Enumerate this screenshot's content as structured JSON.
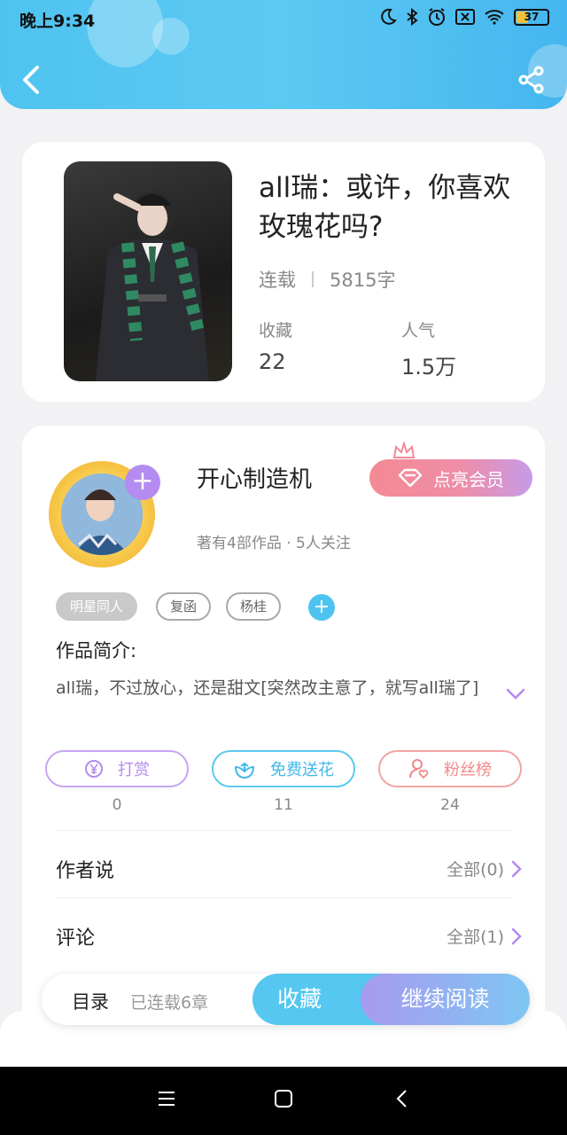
{
  "status_bar": {
    "time": "晚上9:34",
    "battery": "37"
  },
  "book": {
    "title": "all瑞：或许，你喜欢玫瑰花吗?",
    "status": "连载",
    "word_count": "5815字",
    "stats": [
      {
        "label": "收藏",
        "value": "22"
      },
      {
        "label": "人气",
        "value": "1.5万"
      }
    ]
  },
  "author": {
    "name": "开心制造机",
    "vip_label": "点亮会员",
    "meta": "著有4部作品 · 5人关注"
  },
  "tags": [
    "明星同人",
    "复函",
    "杨桂"
  ],
  "intro": {
    "label": "作品简介:",
    "text": "all瑞，不过放心，还是甜文[突然改主意了，就写all瑞了]"
  },
  "actions": [
    {
      "label": "打赏",
      "count": "0",
      "color": "#b48bf0"
    },
    {
      "label": "免费送花",
      "count": "11",
      "color": "#4fc3f0"
    },
    {
      "label": "粉丝榜",
      "count": "24",
      "color": "#f08a8a"
    }
  ],
  "sections": {
    "author_says": {
      "title": "作者说",
      "link": "全部(0)"
    },
    "comments": {
      "title": "评论",
      "link": "全部(1)"
    }
  },
  "bottom_bar": {
    "toc_label": "目录",
    "toc_sub": "已连载6章",
    "favorite": "收藏",
    "continue_reading": "继续阅读"
  }
}
